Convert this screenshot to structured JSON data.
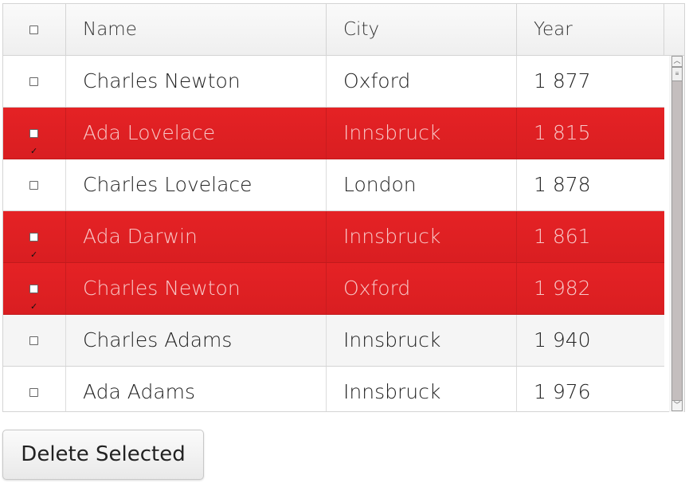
{
  "grid": {
    "columns": [
      "Name",
      "City",
      "Year"
    ],
    "select_all_checked": false,
    "rows": [
      {
        "name": "Charles Newton",
        "city": "Oxford",
        "year": "1 877",
        "selected": false
      },
      {
        "name": "Ada Lovelace",
        "city": "Innsbruck",
        "year": "1 815",
        "selected": true
      },
      {
        "name": "Charles Lovelace",
        "city": "London",
        "year": "1 878",
        "selected": false
      },
      {
        "name": "Ada Darwin",
        "city": "Innsbruck",
        "year": "1 861",
        "selected": true
      },
      {
        "name": "Charles Newton",
        "city": "Oxford",
        "year": "1 982",
        "selected": true
      },
      {
        "name": "Charles Adams",
        "city": "Innsbruck",
        "year": "1 940",
        "selected": false
      },
      {
        "name": "Ada Adams",
        "city": "Innsbruck",
        "year": "1 976",
        "selected": false
      }
    ],
    "selection_color": "#e52225"
  },
  "scrollbar": {
    "up_icon": "chevron-up-icon",
    "down_icon": "chevron-down-icon",
    "thumb_grip": "≡"
  },
  "actions": {
    "delete_selected_label": "Delete Selected"
  }
}
